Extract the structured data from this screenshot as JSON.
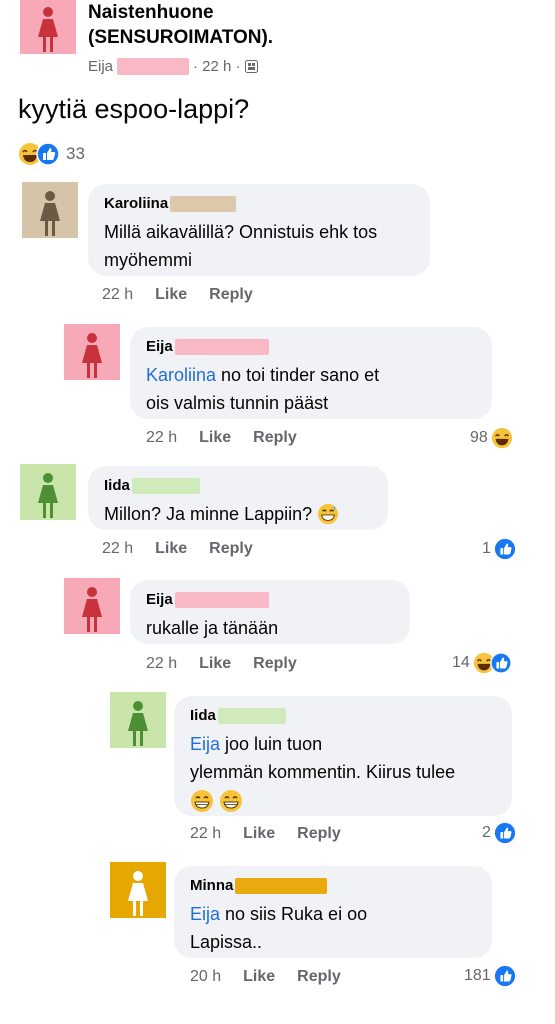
{
  "post": {
    "group_name": "Naistenhuone (SENSUROIMATON).",
    "author": "Eija",
    "time": "· 22 h ·",
    "text": "kyytiä espoo-lappi?",
    "reaction_count": "33"
  },
  "comments": [
    {
      "author": "Karoliina",
      "line1": "Millä aikavälillä? Onnistuis ehk tos",
      "line2": "myöhemmi",
      "time": "22 h",
      "like": "Like",
      "reply": "Reply"
    },
    {
      "author": "Eija",
      "mention": "Karoliina",
      "line1": " no toi tinder sano et",
      "line2": "ois valmis tunnin pääst",
      "time": "22 h",
      "like": "Like",
      "reply": "Reply",
      "reactions": "98"
    },
    {
      "author": "Iida",
      "line1": "Millon? Ja minne Lappiin? ",
      "time": "22 h",
      "like": "Like",
      "reply": "Reply",
      "reactions": "1"
    },
    {
      "author": "Eija",
      "line1": "rukalle ja tänään",
      "time": "22 h",
      "like": "Like",
      "reply": "Reply",
      "reactions": "14"
    },
    {
      "author": "Iida",
      "mention": "Eija",
      "line1": " joo luin tuon",
      "line2": "ylemmän kommentin. Kiirus tulee",
      "time": "22 h",
      "like": "Like",
      "reply": "Reply",
      "reactions": "2"
    },
    {
      "author": "Minna",
      "mention": "Eija",
      "line1": " no siis Ruka ei oo",
      "line2": "Lapissa..",
      "time": "20 h",
      "like": "Like",
      "reply": "Reply",
      "reactions": "181"
    }
  ],
  "colors": {
    "avatar_pink": "#f7a9b8",
    "avatar_tan": "#d6c4a8",
    "avatar_green": "#c9e5a9",
    "avatar_yellow": "#e6a800",
    "redact_pink": "#f9b8c6",
    "redact_tan": "#dcc8aa",
    "redact_green": "#cfeabb",
    "redact_yellow": "#eaa90f",
    "mention_blue": "#216fdb",
    "like_blue": "#1877f2"
  },
  "icons": [
    "female-figure-icon",
    "globe-icon",
    "laugh-emoji-icon",
    "like-thumb-icon",
    "grin-sweat-emoji-icon",
    "beaming-smile-emoji-icon"
  ]
}
